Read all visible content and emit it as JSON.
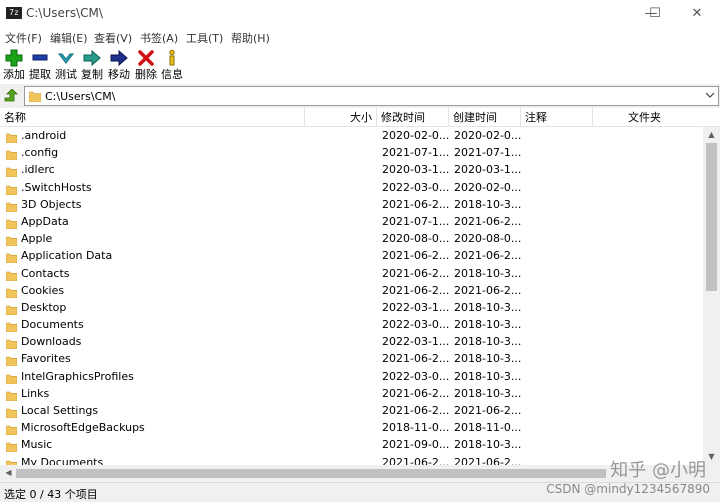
{
  "window": {
    "title": "C:\\Users\\CM\\",
    "app_icon_text": "7z",
    "minimize_glyph": "—",
    "maximize_glyph": "☐",
    "close_glyph": "✕"
  },
  "menu": [
    "文件(F)",
    "编辑(E)",
    "查看(V)",
    "书签(A)",
    "工具(T)",
    "帮助(H)"
  ],
  "toolbar": {
    "add_label": "添加",
    "extract_label": "提取",
    "test_label": "测试",
    "copy_label": "复制",
    "move_label": "移动",
    "delete_label": "删除",
    "info_label": "信息"
  },
  "address": {
    "path": "C:\\Users\\CM\\"
  },
  "columns": {
    "name": "名称",
    "size": "大小",
    "modified": "修改时间",
    "created": "创建时间",
    "comment": "注释",
    "folders": "文件夹"
  },
  "rows": [
    {
      "name": ".android",
      "modified": "2020-02-0...",
      "created": "2020-02-0..."
    },
    {
      "name": ".config",
      "modified": "2021-07-1...",
      "created": "2021-07-1..."
    },
    {
      "name": ".idlerc",
      "modified": "2020-03-1...",
      "created": "2020-03-1..."
    },
    {
      "name": ".SwitchHosts",
      "modified": "2022-03-0...",
      "created": "2020-02-0..."
    },
    {
      "name": "3D Objects",
      "modified": "2021-06-2...",
      "created": "2018-10-3..."
    },
    {
      "name": "AppData",
      "modified": "2021-07-1...",
      "created": "2021-06-2..."
    },
    {
      "name": "Apple",
      "modified": "2020-08-0...",
      "created": "2020-08-0..."
    },
    {
      "name": "Application Data",
      "modified": "2021-06-2...",
      "created": "2021-06-2..."
    },
    {
      "name": "Contacts",
      "modified": "2021-06-2...",
      "created": "2018-10-3..."
    },
    {
      "name": "Cookies",
      "modified": "2021-06-2...",
      "created": "2021-06-2..."
    },
    {
      "name": "Desktop",
      "modified": "2022-03-1...",
      "created": "2018-10-3..."
    },
    {
      "name": "Documents",
      "modified": "2022-03-0...",
      "created": "2018-10-3..."
    },
    {
      "name": "Downloads",
      "modified": "2022-03-1...",
      "created": "2018-10-3..."
    },
    {
      "name": "Favorites",
      "modified": "2021-06-2...",
      "created": "2018-10-3..."
    },
    {
      "name": "IntelGraphicsProfiles",
      "modified": "2022-03-0...",
      "created": "2018-10-3..."
    },
    {
      "name": "Links",
      "modified": "2021-06-2...",
      "created": "2018-10-3..."
    },
    {
      "name": "Local Settings",
      "modified": "2021-06-2...",
      "created": "2021-06-2..."
    },
    {
      "name": "MicrosoftEdgeBackups",
      "modified": "2018-11-0...",
      "created": "2018-11-0..."
    },
    {
      "name": "Music",
      "modified": "2021-09-0...",
      "created": "2018-10-3..."
    },
    {
      "name": "My Documents",
      "modified": "2021-06-2...",
      "created": "2021-06-2..."
    }
  ],
  "status": {
    "text": "选定 0 / 43 个项目"
  },
  "watermark": {
    "line1": "知乎 @小明",
    "line2": "CSDN @mindy1234567890"
  },
  "colors": {
    "folder": "#f2c55c",
    "scroll_thumb": "#c1c1c1",
    "add": "#1aa31a",
    "delete": "#d01010"
  }
}
